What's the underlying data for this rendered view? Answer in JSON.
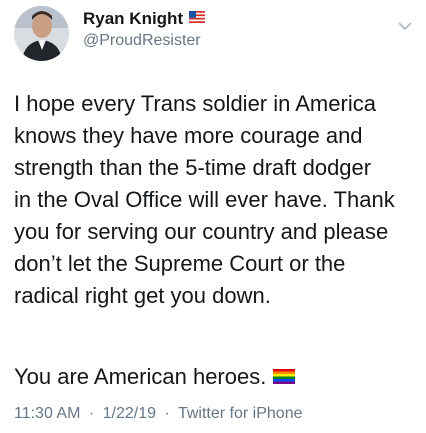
{
  "user": {
    "display_name": "Ryan Knight",
    "handle": "@ProudResister",
    "flag_icon": "us-flag-icon"
  },
  "tweet": {
    "body_lines": [
      "I hope every Trans soldier in America",
      "knows they have more courage and",
      "strength than the 5-time draft dodger",
      "in the Oval Office will ever have. Thank",
      "you for serving our country and please",
      "don’t let the Supreme Court or the",
      "radical right get you down."
    ],
    "second_paragraph": "You are American heroes.",
    "emoji_icon": "rainbow-flag-icon"
  },
  "meta": {
    "time": "11:30 AM",
    "separator": "·",
    "date": "1/22/19",
    "source": "Twitter for iPhone"
  },
  "colors": {
    "text": "#14171a",
    "secondary": "#657786",
    "background": "#ffffff"
  }
}
